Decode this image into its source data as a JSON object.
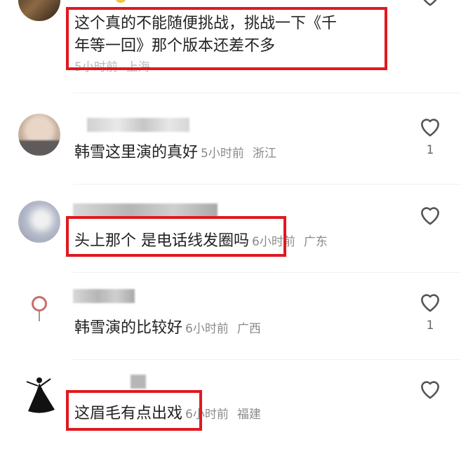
{
  "comments": [
    {
      "text_line1": "这个真的不能随便挑战，挑战一下《千",
      "text_line2": "年等一回》那个版本还差不多",
      "time": "5小时前",
      "location": "上海",
      "highlighted": true
    },
    {
      "text": "韩雪这里演的真好",
      "time": "5小时前",
      "location": "浙江",
      "likes": "1"
    },
    {
      "text": "头上那个 是电话线发圈吗",
      "time": "6小时前",
      "location": "广东",
      "highlighted": true
    },
    {
      "text": "韩雪演的比较好",
      "time": "6小时前",
      "location": "广西",
      "likes": "1"
    },
    {
      "text": "这眉毛有点出戏",
      "time": "6小时前",
      "location": "福建",
      "highlighted": true
    }
  ],
  "colors": {
    "highlight": "#e0191f",
    "meta": "#8a8a8a",
    "text": "#222222"
  },
  "icons": {
    "like": "heart-outline-icon"
  }
}
